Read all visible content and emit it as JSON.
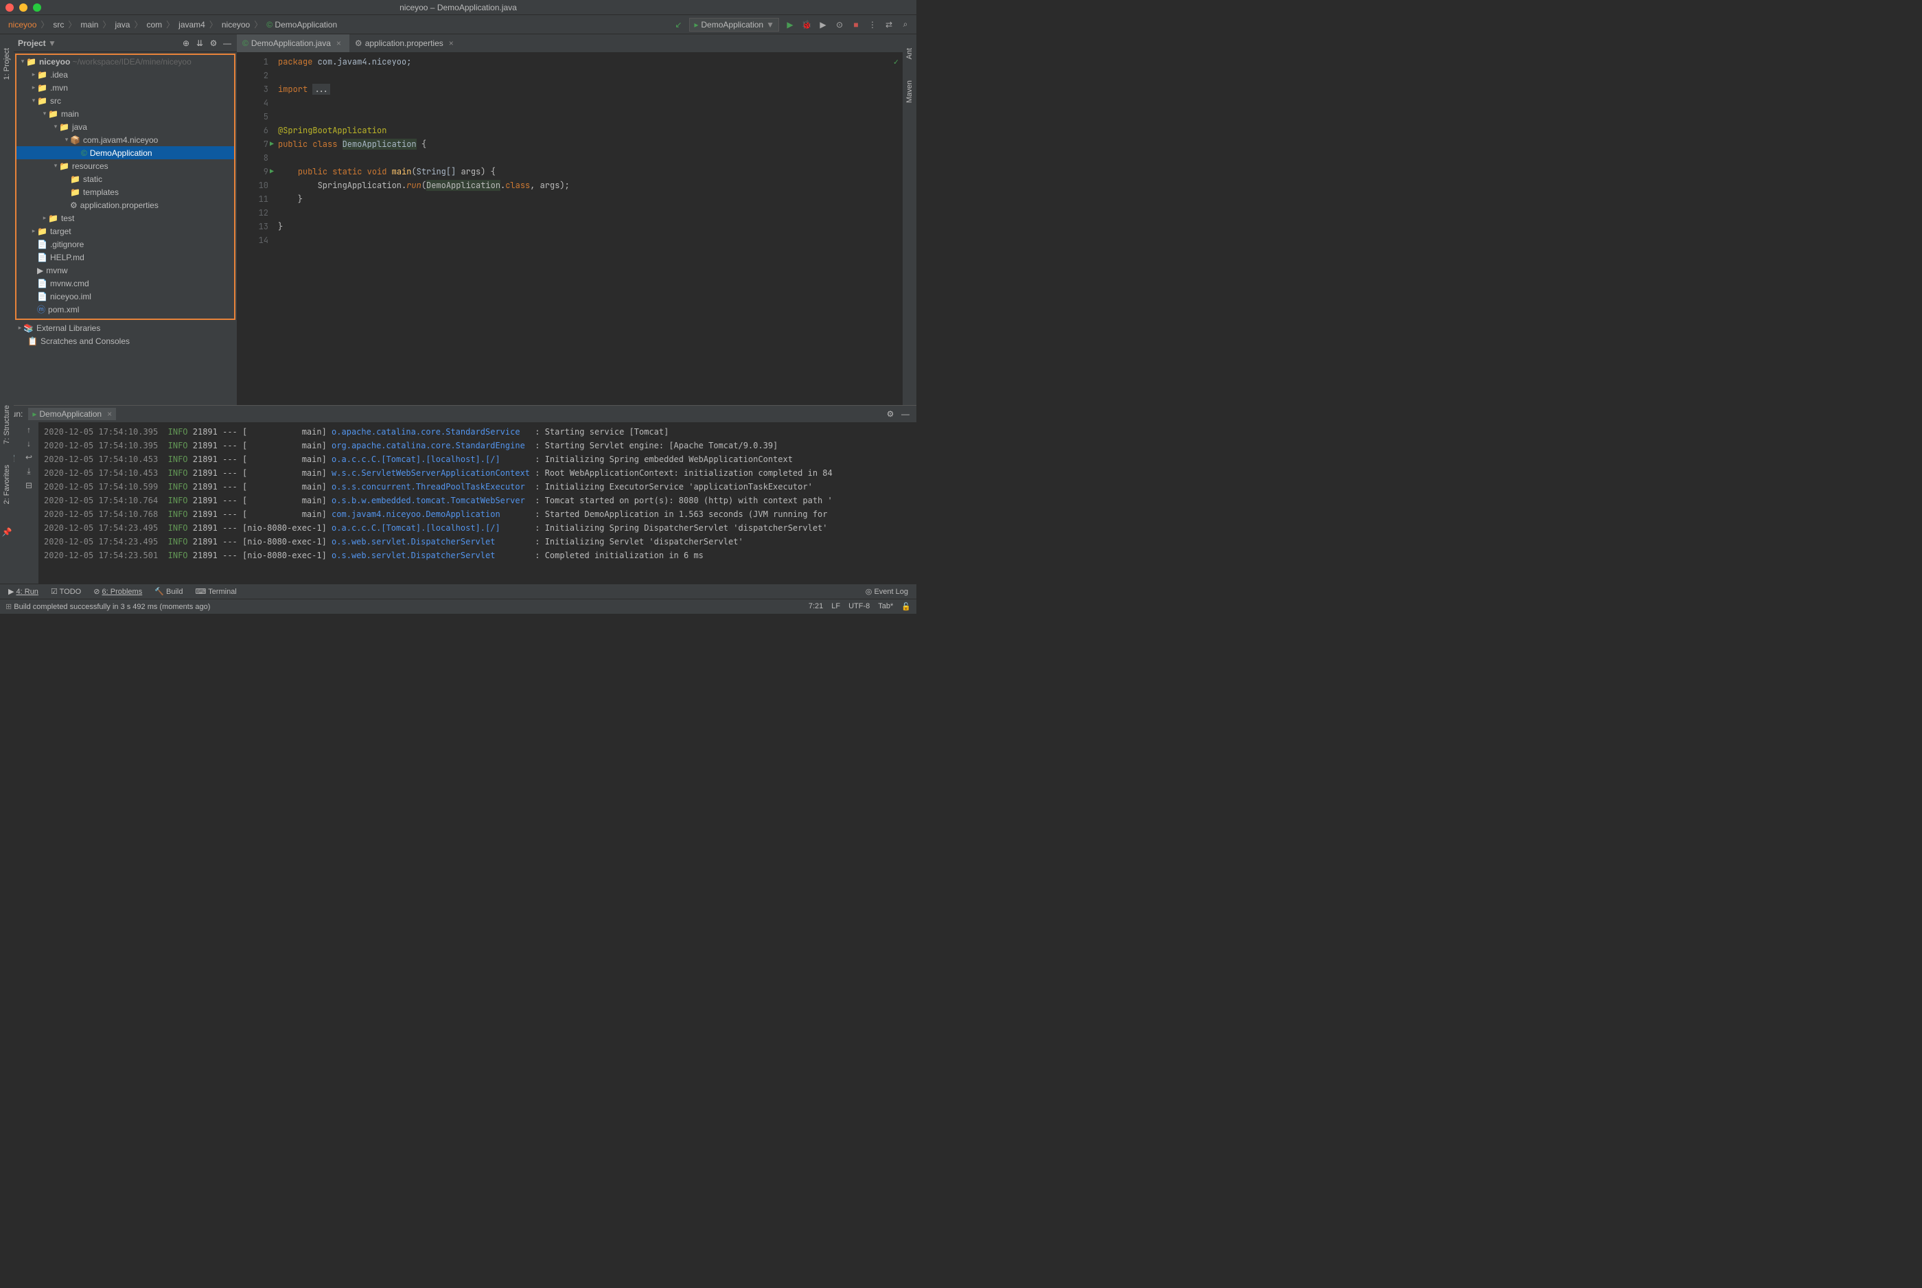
{
  "window": {
    "title": "niceyoo – DemoApplication.java"
  },
  "breadcrumbs": [
    "niceyoo",
    "src",
    "main",
    "java",
    "com",
    "javam4",
    "niceyoo",
    "DemoApplication"
  ],
  "runConfig": "DemoApplication",
  "projectPanel": {
    "title": "Project",
    "rootName": "niceyoo",
    "rootPath": "~/workspace/IDEA/mine/niceyoo",
    "items": [
      {
        "name": ".idea",
        "indent": 1,
        "chev": ">",
        "icon": "folder"
      },
      {
        "name": ".mvn",
        "indent": 1,
        "chev": ">",
        "icon": "folder"
      },
      {
        "name": "src",
        "indent": 1,
        "chev": "v",
        "icon": "folder-blue"
      },
      {
        "name": "main",
        "indent": 2,
        "chev": "v",
        "icon": "folder-blue"
      },
      {
        "name": "java",
        "indent": 3,
        "chev": "v",
        "icon": "folder-blue"
      },
      {
        "name": "com.javam4.niceyoo",
        "indent": 4,
        "chev": "v",
        "icon": "package"
      },
      {
        "name": "DemoApplication",
        "indent": 5,
        "chev": "",
        "icon": "class",
        "selected": true
      },
      {
        "name": "resources",
        "indent": 3,
        "chev": "v",
        "icon": "folder-res"
      },
      {
        "name": "static",
        "indent": 4,
        "chev": "",
        "icon": "folder"
      },
      {
        "name": "templates",
        "indent": 4,
        "chev": "",
        "icon": "folder"
      },
      {
        "name": "application.properties",
        "indent": 4,
        "chev": "",
        "icon": "props"
      },
      {
        "name": "test",
        "indent": 2,
        "chev": ">",
        "icon": "folder-blue"
      },
      {
        "name": "target",
        "indent": 1,
        "chev": ">",
        "icon": "folder-orange"
      },
      {
        "name": ".gitignore",
        "indent": 1,
        "chev": "",
        "icon": "file"
      },
      {
        "name": "HELP.md",
        "indent": 1,
        "chev": "",
        "icon": "md"
      },
      {
        "name": "mvnw",
        "indent": 1,
        "chev": "",
        "icon": "sh"
      },
      {
        "name": "mvnw.cmd",
        "indent": 1,
        "chev": "",
        "icon": "file"
      },
      {
        "name": "niceyoo.iml",
        "indent": 1,
        "chev": "",
        "icon": "file"
      },
      {
        "name": "pom.xml",
        "indent": 1,
        "chev": "",
        "icon": "maven"
      }
    ],
    "externalLibraries": "External Libraries",
    "scratches": "Scratches and Consoles"
  },
  "tabs": [
    {
      "name": "DemoApplication.java",
      "active": true,
      "icon": "class"
    },
    {
      "name": "application.properties",
      "active": false,
      "icon": "props"
    }
  ],
  "code": {
    "lines": [
      {
        "n": 1,
        "html": "<span class='kw'>package</span> <span class='pkg'>com.javam4.niceyoo;</span>"
      },
      {
        "n": 2,
        "html": ""
      },
      {
        "n": 3,
        "html": "<span class='kw'>import</span> <span style='background:#3c3f41;padding:0 2px'>...</span>"
      },
      {
        "n": 4,
        "html": ""
      },
      {
        "n": 5,
        "html": ""
      },
      {
        "n": 6,
        "html": "<span class='anno'>@SpringBootApplication</span>"
      },
      {
        "n": 7,
        "html": "<span class='kw'>public class</span> <span class='cls bg-h'>DemoApplication</span> {",
        "run": true
      },
      {
        "n": 8,
        "html": ""
      },
      {
        "n": 9,
        "html": "    <span class='kw'>public static void</span> <span class='method'>main</span>(<span class='cls'>String[]</span> args) {",
        "run": true
      },
      {
        "n": 10,
        "html": "        SpringApplication.<span class='kw2'>run</span>(<span class='bg-h'>DemoApplication</span>.<span class='kw'>class</span>, args);"
      },
      {
        "n": 11,
        "html": "    }"
      },
      {
        "n": 12,
        "html": ""
      },
      {
        "n": 13,
        "html": "}"
      },
      {
        "n": 14,
        "html": ""
      }
    ]
  },
  "runPanel": {
    "label": "Run:",
    "tabName": "DemoApplication",
    "logs": [
      {
        "ts": "2020-12-05 17:54:10.395",
        "lvl": "INFO",
        "pid": "21891",
        "th": "[           main]",
        "cls": "o.apache.catalina.core.StandardService  ",
        "msg": ": Starting service [Tomcat]"
      },
      {
        "ts": "2020-12-05 17:54:10.395",
        "lvl": "INFO",
        "pid": "21891",
        "th": "[           main]",
        "cls": "org.apache.catalina.core.StandardEngine ",
        "msg": ": Starting Servlet engine: [Apache Tomcat/9.0.39]"
      },
      {
        "ts": "2020-12-05 17:54:10.453",
        "lvl": "INFO",
        "pid": "21891",
        "th": "[           main]",
        "cls": "o.a.c.c.C.[Tomcat].[localhost].[/]      ",
        "msg": ": Initializing Spring embedded WebApplicationContext"
      },
      {
        "ts": "2020-12-05 17:54:10.453",
        "lvl": "INFO",
        "pid": "21891",
        "th": "[           main]",
        "cls": "w.s.c.ServletWebServerApplicationContext",
        "msg": ": Root WebApplicationContext: initialization completed in 84"
      },
      {
        "ts": "2020-12-05 17:54:10.599",
        "lvl": "INFO",
        "pid": "21891",
        "th": "[           main]",
        "cls": "o.s.s.concurrent.ThreadPoolTaskExecutor ",
        "msg": ": Initializing ExecutorService 'applicationTaskExecutor'"
      },
      {
        "ts": "2020-12-05 17:54:10.764",
        "lvl": "INFO",
        "pid": "21891",
        "th": "[           main]",
        "cls": "o.s.b.w.embedded.tomcat.TomcatWebServer ",
        "msg": ": Tomcat started on port(s): 8080 (http) with context path '"
      },
      {
        "ts": "2020-12-05 17:54:10.768",
        "lvl": "INFO",
        "pid": "21891",
        "th": "[           main]",
        "cls": "com.javam4.niceyoo.DemoApplication      ",
        "msg": ": Started DemoApplication in 1.563 seconds (JVM running for "
      },
      {
        "ts": "2020-12-05 17:54:23.495",
        "lvl": "INFO",
        "pid": "21891",
        "th": "[nio-8080-exec-1]",
        "cls": "o.a.c.c.C.[Tomcat].[localhost].[/]      ",
        "msg": ": Initializing Spring DispatcherServlet 'dispatcherServlet'"
      },
      {
        "ts": "2020-12-05 17:54:23.495",
        "lvl": "INFO",
        "pid": "21891",
        "th": "[nio-8080-exec-1]",
        "cls": "o.s.web.servlet.DispatcherServlet       ",
        "msg": ": Initializing Servlet 'dispatcherServlet'"
      },
      {
        "ts": "2020-12-05 17:54:23.501",
        "lvl": "INFO",
        "pid": "21891",
        "th": "[nio-8080-exec-1]",
        "cls": "o.s.web.servlet.DispatcherServlet       ",
        "msg": ": Completed initialization in 6 ms"
      }
    ]
  },
  "bottomTabs": {
    "run": "4: Run",
    "todo": "TODO",
    "problems": "6: Problems",
    "build": "Build",
    "terminal": "Terminal",
    "eventLog": "Event Log"
  },
  "statusBar": {
    "msg": "Build completed successfully in 3 s 492 ms (moments ago)",
    "pos": "7:21",
    "sep": "LF",
    "enc": "UTF-8",
    "indent": "Tab*"
  },
  "leftStrip": {
    "project": "1: Project",
    "structure": "7: Structure",
    "favorites": "2: Favorites"
  },
  "rightStrip": {
    "ant": "Ant",
    "maven": "Maven"
  }
}
